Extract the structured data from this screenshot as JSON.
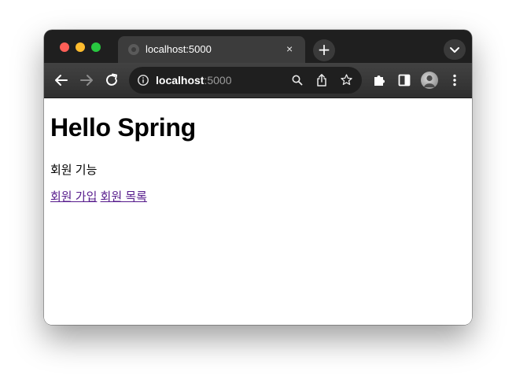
{
  "browser": {
    "tab": {
      "title": "localhost:5000",
      "close_glyph": "×"
    },
    "new_tab_glyph": "+",
    "omnibox": {
      "host": "localhost",
      "port": ":5000"
    },
    "icons": {
      "back": "back-arrow-icon",
      "forward": "forward-arrow-icon",
      "reload": "reload-icon",
      "site_info": "info-icon",
      "zoom": "search-icon",
      "share": "share-icon",
      "bookmark": "star-icon",
      "extensions": "puzzle-icon",
      "side_panel": "side-panel-icon",
      "menu": "kebab-menu-icon",
      "tab_search": "chevron-down-icon"
    }
  },
  "page": {
    "heading": "Hello Spring",
    "feature_label": "회원 기능",
    "links": [
      {
        "label": "회원 가입"
      },
      {
        "label": "회원 목록"
      }
    ]
  },
  "colors": {
    "tabstrip_bg": "#1f1f1f",
    "active_tab_bg": "#3c3c3c",
    "toolbar_bg": "#3a3a3a",
    "link_visited": "#551a8b"
  }
}
